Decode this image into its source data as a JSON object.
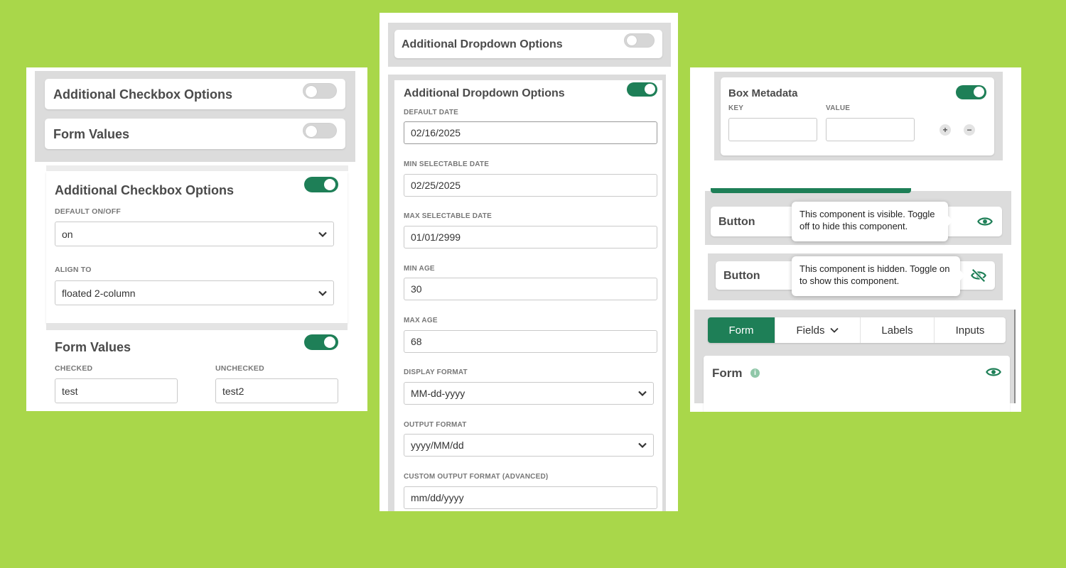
{
  "colors": {
    "background": "#a9d74a",
    "accent": "#1e7f57",
    "panel_gray": "#dcdcdc"
  },
  "checkbox_panel": {
    "collapsed_card_1": {
      "title": "Additional Checkbox Options",
      "toggle": "off"
    },
    "collapsed_card_2": {
      "title": "Form Values",
      "toggle": "off"
    },
    "checkbox_options": {
      "title": "Additional Checkbox Options",
      "toggle": "on",
      "default_label": "DEFAULT ON/OFF",
      "default_value": "on",
      "align_label": "ALIGN TO",
      "align_value": "floated 2-column"
    },
    "form_values": {
      "title": "Form Values",
      "toggle": "on",
      "checked_label": "CHECKED",
      "checked_value": "test",
      "unchecked_label": "UNCHECKED",
      "unchecked_value": "test2"
    }
  },
  "date_panel": {
    "collapsed_card": {
      "title": "Additional Dropdown Options",
      "toggle": "off"
    },
    "expanded_card": {
      "title": "Additional Dropdown Options",
      "toggle": "on",
      "default_date_label": "DEFAULT DATE",
      "default_date": "02/16/2025",
      "min_date_label": "MIN SELECTABLE DATE",
      "min_date": "02/25/2025",
      "max_date_label": "MAX SELECTABLE DATE",
      "max_date": "01/01/2999",
      "min_age_label": "MIN AGE",
      "min_age": "30",
      "max_age_label": "MAX AGE",
      "max_age": "68",
      "display_format_label": "DISPLAY FORMAT",
      "display_format": "MM-dd-yyyy",
      "output_format_label": "OUTPUT FORMAT",
      "output_format": "yyyy/MM/dd",
      "custom_output_label": "CUSTOM OUTPUT FORMAT (ADVANCED)",
      "custom_output": "mm/dd/yyyy"
    }
  },
  "right_panel": {
    "box_metadata": {
      "title": "Box Metadata",
      "toggle": "on",
      "key_label": "KEY",
      "value_label": "VALUE",
      "add_symbol": "+",
      "remove_symbol": "−"
    },
    "visible_component": {
      "name": "Button",
      "tooltip": "This component is visible. Toggle off to hide this component.",
      "icon": "eye-icon"
    },
    "hidden_component": {
      "name": "Button",
      "tooltip": "This component is hidden. Toggle on to show this component.",
      "icon": "eye-off-icon"
    },
    "tabs": [
      {
        "label": "Form",
        "active": true
      },
      {
        "label": "Fields",
        "active": false,
        "dropdown": true
      },
      {
        "label": "Labels",
        "active": false
      },
      {
        "label": "Inputs",
        "active": false
      }
    ],
    "form_card": {
      "title": "Form",
      "info_icon": "info-icon",
      "visibility_icon": "eye-icon"
    }
  }
}
